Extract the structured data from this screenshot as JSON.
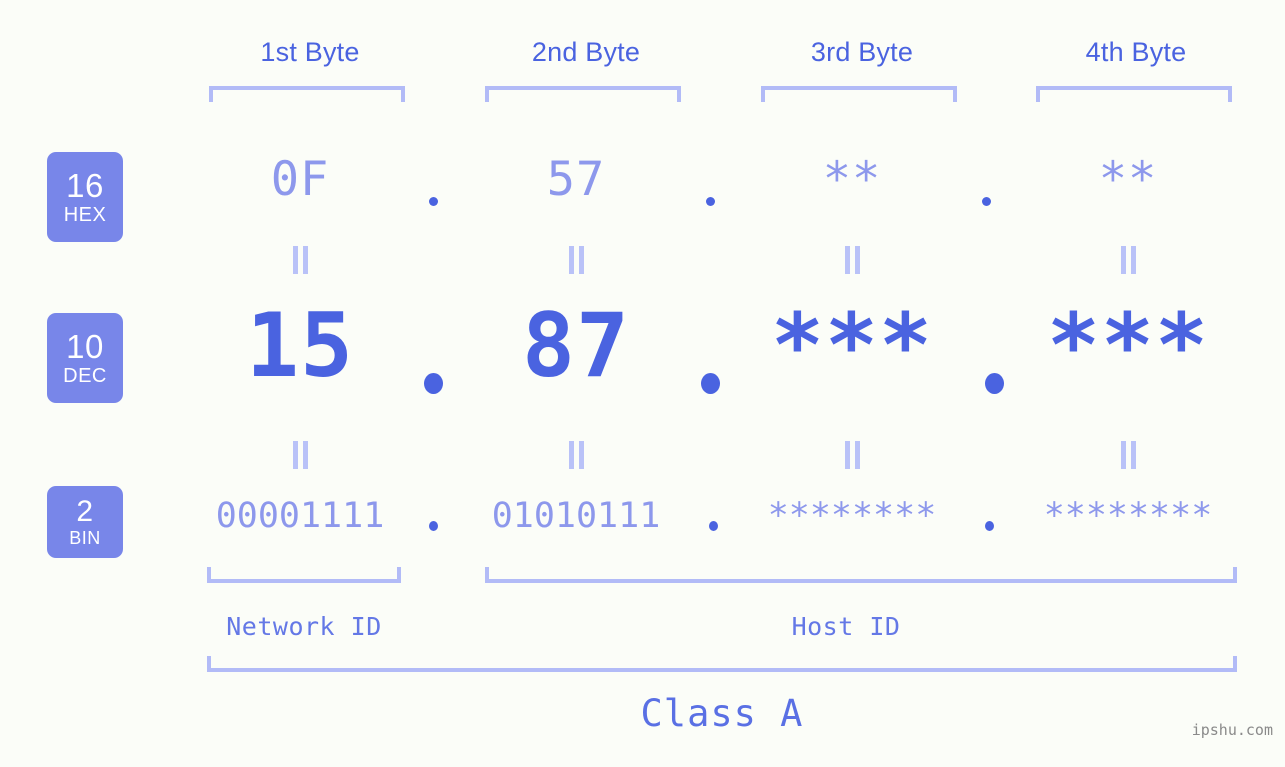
{
  "meta": {
    "background_color": "#fbfdf8",
    "accent_color": "#4a63e0",
    "muted_accent_color": "#8d98ec",
    "bracket_color": "#b2bbf7",
    "badge_color": "#7886e9"
  },
  "headers": {
    "byte1": "1st Byte",
    "byte2": "2nd Byte",
    "byte3": "3rd Byte",
    "byte4": "4th Byte"
  },
  "bases": [
    {
      "number": "16",
      "name": "HEX"
    },
    {
      "number": "10",
      "name": "DEC"
    },
    {
      "number": "2",
      "name": "BIN"
    }
  ],
  "rows": {
    "hex": {
      "base_number": "16",
      "base_name": "HEX",
      "octets": [
        "0F",
        "57",
        "**",
        "**"
      ],
      "separator": "."
    },
    "dec": {
      "base_number": "10",
      "base_name": "DEC",
      "octets": [
        "15",
        "87",
        "***",
        "***"
      ],
      "separator": "."
    },
    "bin": {
      "base_number": "2",
      "base_name": "BIN",
      "octets": [
        "00001111",
        "01010111",
        "********",
        "********"
      ],
      "separator": "."
    }
  },
  "equivalence_mark": "||",
  "footer": {
    "network_id": "Network ID",
    "host_id": "Host ID",
    "class": "Class A",
    "watermark": "ipshu.com"
  }
}
